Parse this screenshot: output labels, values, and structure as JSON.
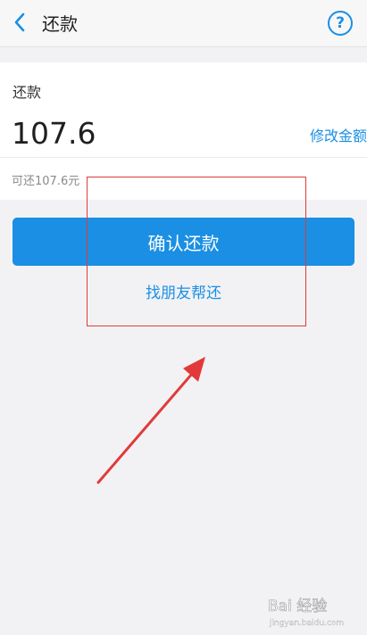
{
  "header": {
    "title": "还款",
    "back_icon": "chevron-left-icon",
    "help_icon": "question-circle-icon",
    "help_glyph": "?"
  },
  "repayment": {
    "label": "还款",
    "amount": "107.6",
    "modify_label": "修改金额",
    "available_text": "可还107.6元"
  },
  "actions": {
    "confirm_label": "确认还款",
    "friend_label": "找朋友帮还"
  },
  "colors": {
    "accent": "#1a8fe3",
    "annotation": "#e23a3a",
    "background": "#f2f2f5"
  },
  "watermark": {
    "text": "Bai 经验",
    "subtext": "jingyan.baidu.com"
  }
}
